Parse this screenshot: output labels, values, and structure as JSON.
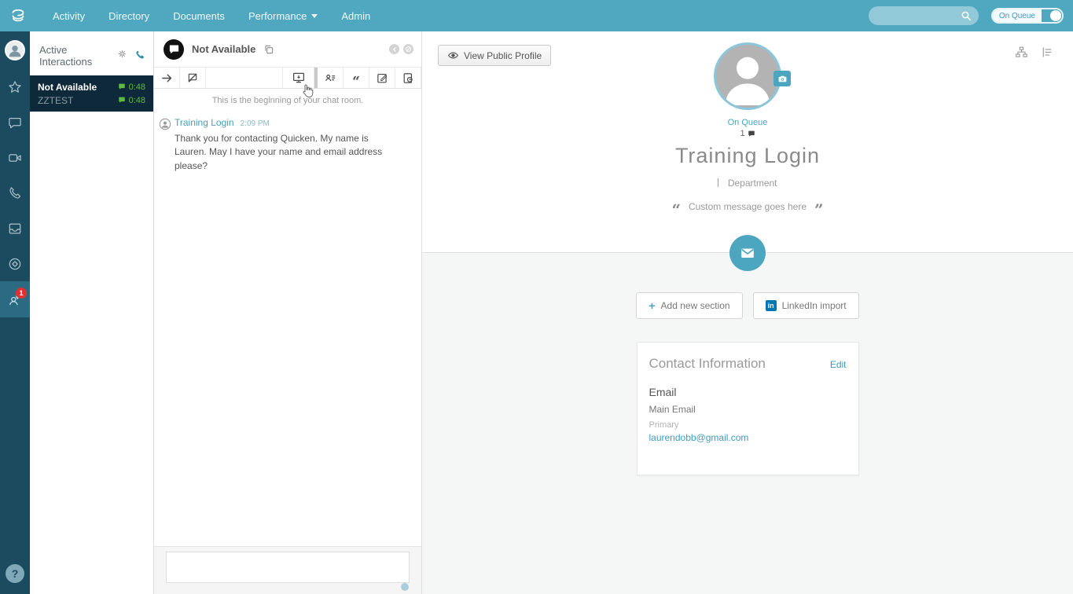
{
  "nav": {
    "items": [
      {
        "label": "Activity"
      },
      {
        "label": "Directory"
      },
      {
        "label": "Documents"
      },
      {
        "label": "Performance"
      },
      {
        "label": "Admin"
      }
    ],
    "search_value": "",
    "on_queue_label": "On Queue"
  },
  "rail": {
    "badge_count": "1",
    "help_glyph": "?"
  },
  "interactions": {
    "title": "Active Interactions",
    "items": [
      {
        "name": "Not Available",
        "duration": "0:48"
      },
      {
        "name": "ZZTEST",
        "duration": "0:48"
      }
    ]
  },
  "chat": {
    "header_name": "Not Available",
    "system_message": "This is the beginning of your chat room.",
    "messages": [
      {
        "author": "Training Login",
        "time": "2:09 PM",
        "text": "Thank you for contacting Quicken. My name is Lauren. May I have your name and email address please?"
      }
    ],
    "input_value": ""
  },
  "profile": {
    "view_public_profile": "View Public Profile",
    "status": "On Queue",
    "chat_count": "1",
    "name": "Training Login",
    "department": "Department",
    "custom_message": "Custom message goes here",
    "add_section_label": "Add new section",
    "linkedin_label": "LinkedIn import",
    "contact": {
      "title": "Contact Information",
      "edit_label": "Edit",
      "email_heading": "Email",
      "email_label": "Main Email",
      "email_type": "Primary",
      "email_value": "laurendobb@gmail.com"
    }
  },
  "icons": {
    "quote_open": "“",
    "quote_close": "”",
    "plus": "+",
    "linkedin": "in",
    "help": "?"
  },
  "colors": {
    "nav_teal": "#4FA8C0",
    "sidebar_dark": "#1C4A5E",
    "sidebar_active": "#2B6A80",
    "interaction_list_dark": "#0E2A3A",
    "accent_teal": "#3E9BBF",
    "duration_green": "#5FBA3D",
    "badge_red": "#E03131",
    "linkedin_blue": "#0077B5"
  }
}
